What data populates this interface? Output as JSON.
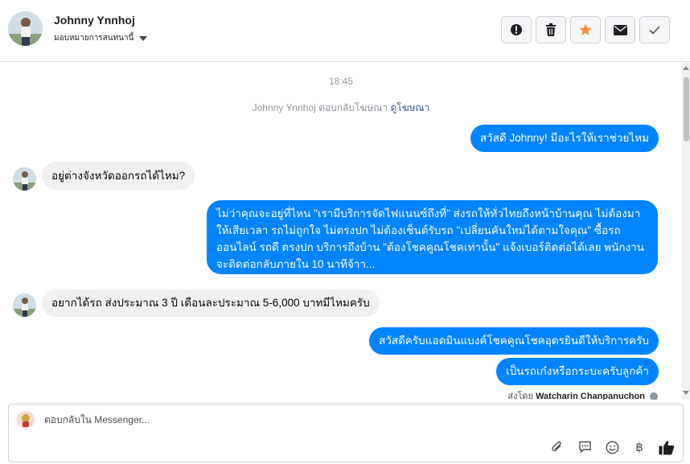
{
  "contact": {
    "name": "Johnny Ynnhoj",
    "assign_label": "มอบหมายการสนทนานี้"
  },
  "header_actions": [
    {
      "icon": "alert-icon"
    },
    {
      "icon": "trash-icon"
    },
    {
      "icon": "star-icon",
      "color": "#f7923b"
    },
    {
      "icon": "mail-icon"
    },
    {
      "icon": "check-icon"
    }
  ],
  "conversation": {
    "timestamp": "18:45",
    "ad_reply": {
      "text": "Johnny Ynnhoj ตอบกลับโฆษณา",
      "link": "ดูโฆษณา"
    },
    "messages": [
      {
        "from": "page",
        "text": "สวัสดี Johnny! มีอะไรให้เราช่วยไหม"
      },
      {
        "from": "customer",
        "text": "อยู่ต่างจังหวัดออกรถได้ไหม?"
      },
      {
        "from": "page",
        "text": "ไม่ว่าคุณจะอยู่ที่ไหน \"เรามีบริการจัดไฟแนนซ์ถึงที่\"  ส่งรถให้ทั่วไทยถึงหน้าบ้านคุณ ไม่ต้องมาให้เสียเวลา รถไม่ถูกใจ ไม่ตรงปก ไม่ต้องเซ็นต์รับรถ \"เปลี่ยนคันใหม่ได้ตามใจคุณ\" ซื้อรถออนไลน์ รถดี ตรงปก บริการถึงบ้าน \"ต้องโชคคูณโชคเท่านั้น\" แจ้งเบอร์ติดต่อได้เลย พนักงานจะติดต่อกลับภายใน 10 นาทีจ้าา..."
      },
      {
        "from": "customer",
        "text": "อยากได้รถ ส่งประมาณ 3 ปี เดือนละประมาณ 5-6,000 บาทมีไหมครับ"
      },
      {
        "from": "page",
        "text": "สวัสดีครับแอดมินแบงค์โชคคูณโชคอุดรยินดีให้บริการครับ"
      },
      {
        "from": "page",
        "text": "เป็นรถเก๋งหรือกระบะครับลูกค้า"
      }
    ],
    "sent_by_label": "ส่งโดย",
    "sent_by_name": "Watcharin Chanpanuchon"
  },
  "composer": {
    "placeholder": "ตอบกลับใน Messenger..."
  },
  "composer_tools": [
    "attach-icon",
    "saved-reply-icon",
    "emoji-icon",
    "baht-icon",
    "like-icon"
  ],
  "colors": {
    "outgoing_bubble": "#0084ff",
    "incoming_bubble": "#f1f0f0",
    "like": "#1c1e21"
  }
}
